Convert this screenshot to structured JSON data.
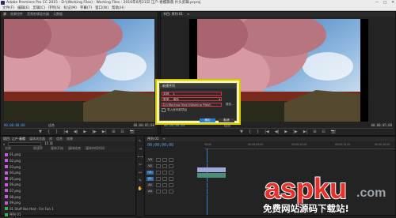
{
  "window": {
    "title": "Adobe Premiere Pro CC 2015 - D:\\(Working Files) - Working Files - 2016年6月21日 江户-春樱飘落 片头剪辑.prproj",
    "controls": [
      "—",
      "□",
      "✕"
    ]
  },
  "menu": [
    "文件(F)",
    "编辑(E)",
    "剪辑(C)",
    "序列(S)",
    "标记(M)",
    "字幕(T)",
    "窗口(W)",
    "帮助(H)"
  ],
  "source": {
    "tabs": [
      "源",
      "效果控件",
      "音频剪辑混合器",
      "元数据"
    ],
    "timecode_left": "00;00;00;00",
    "timecode_right": "00;00;05;00",
    "fit": "适合",
    "controls": [
      "▼",
      "{",
      "}",
      "|◀",
      "◀|",
      "▶",
      "|▶",
      "▶|",
      "⊞",
      "⊟",
      "📷"
    ]
  },
  "program": {
    "tabs": [
      "节目: 序列 01",
      "≡"
    ],
    "timecode_left": "00;00;00;00",
    "timecode_right": "00;00;05;00",
    "fit": "适合",
    "controls": [
      "▼",
      "{",
      "}",
      "|◀",
      "◀|",
      "▶",
      "|▶",
      "▶|",
      "⊞",
      "⊟",
      "📷"
    ]
  },
  "project": {
    "tabs": [
      "项目: 江户-春樱",
      "媒体浏览器",
      "库",
      "信息",
      "效果"
    ],
    "search_placeholder": "",
    "count": "15 项",
    "columns": [
      "名称",
      "帧速率",
      "媒体开始",
      "媒体结束",
      "媒体持续时间"
    ],
    "rows": [
      {
        "name": "01.png",
        "color": "#c35fd5"
      },
      {
        "name": "02.png",
        "color": "#c35fd5"
      },
      {
        "name": "03.png",
        "color": "#c35fd5"
      },
      {
        "name": "04.png",
        "color": "#c35fd5"
      },
      {
        "name": "05.png",
        "color": "#c35fd5"
      },
      {
        "name": "06.png",
        "color": "#c35fd5"
      },
      {
        "name": "07.png",
        "color": "#c35fd5"
      },
      {
        "name": "08.png",
        "color": "#c35fd5"
      },
      {
        "name": "09.png",
        "color": "#c35fd5"
      },
      {
        "name": "01 Stuff like that - For Fun 1",
        "color": "#3fae5a"
      },
      {
        "name": "序列 01",
        "color": "#3fae5a"
      }
    ]
  },
  "timeline": {
    "tabs": [
      "序列 01",
      "≡"
    ],
    "timecode": "00;00;00;00",
    "ruler": [
      "00;00",
      "00;00;05;00",
      "00;00;10;00",
      "00;00;15;00",
      "00;00;20;00"
    ],
    "tracks": [
      "V3",
      "V2",
      "V1",
      "A1",
      "A2",
      "A3"
    ]
  },
  "dialog": {
    "title": "新建序列",
    "name_label": "名称:",
    "name_value": "1",
    "type_label": "类型:",
    "type_value": "保存",
    "path_value": "D:\\(Working Files)\\(Working Files)\\",
    "browse": "浏览...",
    "subtitle_label": "导入序列到项目",
    "ok": "确定",
    "cancel": "取消"
  },
  "watermark": {
    "brand": "aspku",
    "tld": ".com",
    "slogan": "免费网站源码下载站!"
  }
}
